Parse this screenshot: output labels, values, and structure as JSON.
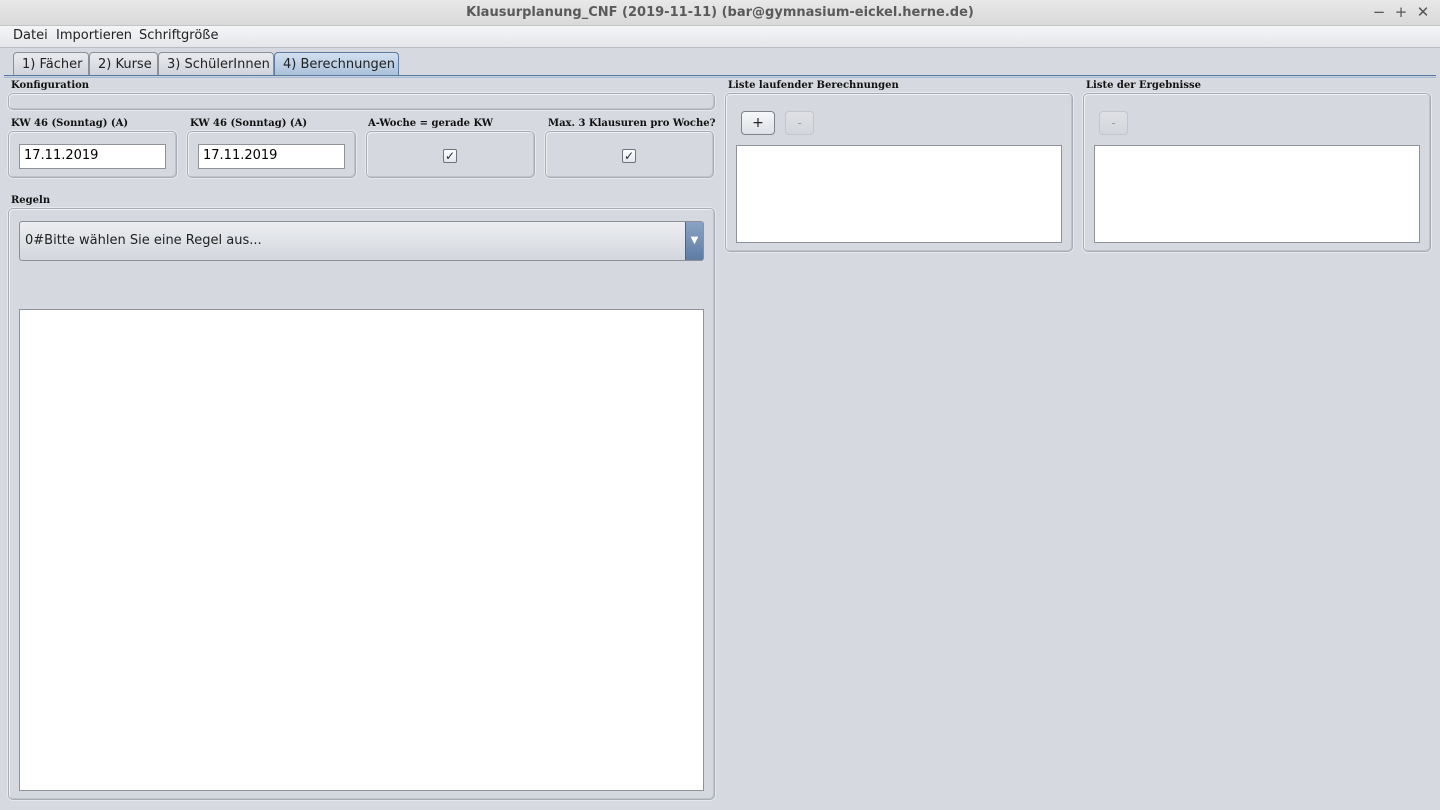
{
  "window": {
    "title": "Klausurplanung_CNF (2019-11-11) (bar@gymnasium-eickel.herne.de)",
    "minimize": "−",
    "maximize": "+",
    "close": "✕"
  },
  "menu": [
    "Datei",
    "Importieren",
    "Schriftgröße"
  ],
  "tabs": [
    "1) Fächer",
    "2) Kurse",
    "3) SchülerInnen",
    "4) Berechnungen"
  ],
  "active_tab": "4) Berechnungen",
  "config": {
    "title": "Konfiguration",
    "start_label": "KW 46 (Sonntag) (A)",
    "start_value": "17.11.2019",
    "end_label": "KW 46 (Sonntag) (A)",
    "end_value": "17.11.2019",
    "aweek_label": "A-Woche = gerade KW",
    "aweek_checked": "☑",
    "max_label": "Max. 3 Klausuren pro Woche?",
    "max_checked": "☑"
  },
  "rules": {
    "title": "Regeln",
    "selected": "0#Bitte wählen Sie eine Regel aus...",
    "arrow": "▼"
  },
  "running": {
    "title": "Liste laufender Berechnungen",
    "add_label": "+",
    "remove_label": "-"
  },
  "results": {
    "title": "Liste der Ergebnisse",
    "remove_label": "-"
  }
}
